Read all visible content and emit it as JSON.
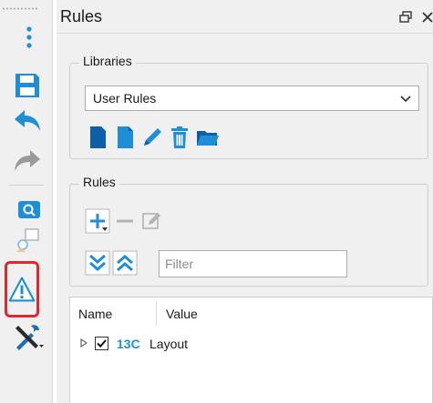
{
  "panel": {
    "title": "Rules",
    "float_icon": "float-window-icon",
    "close_icon": "close-icon"
  },
  "toolbar": {
    "items": [
      {
        "icon": "more-options-icon"
      },
      {
        "icon": "save-icon"
      },
      {
        "icon": "undo-icon"
      },
      {
        "icon": "redo-icon"
      },
      {
        "icon": "inspect-icon"
      },
      {
        "icon": "shapes-icon"
      },
      {
        "icon": "warning-icon",
        "highlighted": true
      },
      {
        "icon": "tools-icon"
      }
    ]
  },
  "libraries": {
    "legend": "Libraries",
    "selected": "User Rules",
    "buttons": [
      "new-document-icon",
      "copy-document-icon",
      "edit-pencil-icon",
      "delete-trash-icon",
      "open-folder-icon"
    ]
  },
  "rules": {
    "legend": "Rules",
    "filter_placeholder": "Filter",
    "buttons": [
      "add-icon",
      "remove-icon",
      "edit-icon",
      "expand-all-icon",
      "collapse-all-icon"
    ]
  },
  "tree": {
    "columns": [
      "Name",
      "Value"
    ],
    "rows": [
      {
        "id": "13C",
        "name": "Layout",
        "checked": true
      }
    ]
  },
  "colors": {
    "accent_blue": "#1e8fd6",
    "highlight_red": "#e0272d"
  }
}
